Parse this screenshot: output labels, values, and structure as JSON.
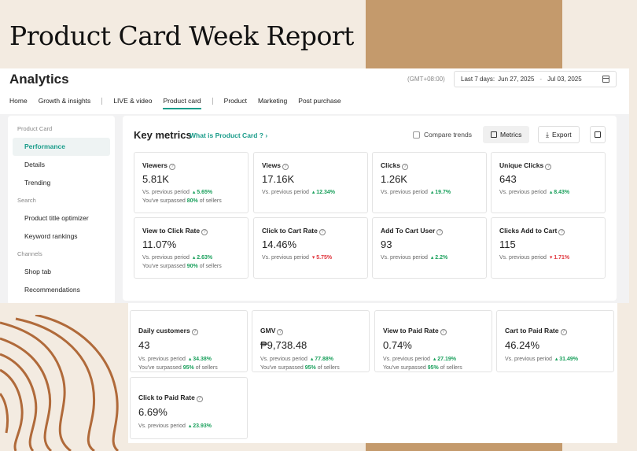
{
  "slide_title": "Product Card Week Report",
  "header": {
    "title": "Analytics",
    "timezone": "(GMT+08:00)",
    "date_label": "Last 7 days:",
    "date_start": "Jun 27, 2025",
    "date_sep": "-",
    "date_end": "Jul 03, 2025"
  },
  "nav": {
    "home": "Home",
    "growth": "Growth & insights",
    "live": "LIVE & video",
    "product_card": "Product card",
    "product": "Product",
    "marketing": "Marketing",
    "post_purchase": "Post purchase"
  },
  "sidebar": {
    "section_product_card": "Product Card",
    "performance": "Performance",
    "details": "Details",
    "trending": "Trending",
    "section_search": "Search",
    "title_optimizer": "Product title optimizer",
    "keyword_rankings": "Keyword rankings",
    "section_channels": "Channels",
    "shop_tab": "Shop tab",
    "recommendations": "Recommendations"
  },
  "key_metrics": {
    "title": "Key metrics",
    "link": "What is Product Card ? ›",
    "compare": "Compare trends",
    "metrics_btn": "Metrics",
    "export_btn": "Export"
  },
  "prev_label": "Vs. previous period",
  "surpass_prefix": "You've surpassed",
  "surpass_suffix": "of sellers",
  "metrics": [
    {
      "label": "Viewers",
      "value": "5.81K",
      "change": "▴ 5.65%",
      "surpass": "80%"
    },
    {
      "label": "Views",
      "value": "17.16K",
      "change": "▴ 12.34%"
    },
    {
      "label": "Clicks",
      "value": "1.26K",
      "change": "▴ 19.7%"
    },
    {
      "label": "Unique Clicks",
      "value": "643",
      "change": "▴ 8.43%"
    },
    {
      "label": "View to Click Rate",
      "value": "11.07%",
      "change": "▴ 2.63%",
      "surpass": "90%"
    },
    {
      "label": "Click to Cart Rate",
      "value": "14.46%",
      "change": "▾ 5.75%"
    },
    {
      "label": "Add To Cart User",
      "value": "93",
      "change": "▴ 2.2%"
    },
    {
      "label": "Clicks Add to Cart",
      "value": "115",
      "change": "▾ 1.71%"
    }
  ],
  "metrics2": [
    {
      "label": "Daily customers",
      "value": "43",
      "change": "▴ 34.38%",
      "surpass": "95%"
    },
    {
      "label": "GMV",
      "value": "₱9,738.48",
      "change": "▴ 77.88%",
      "surpass": "95%"
    },
    {
      "label": "View to Paid Rate",
      "value": "0.74%",
      "change": "▴ 27.19%",
      "surpass": "95%"
    },
    {
      "label": "Cart to Paid Rate",
      "value": "46.24%",
      "change": "▴ 31.49%"
    },
    {
      "label": "Click to Paid Rate",
      "value": "6.69%",
      "change": "▴ 23.93%"
    }
  ]
}
